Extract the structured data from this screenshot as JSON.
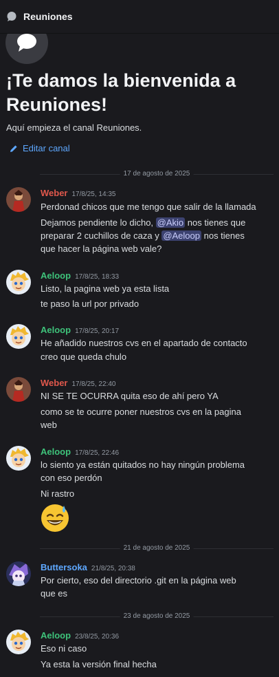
{
  "channel": {
    "name": "Reuniones",
    "welcome_title": "¡Te damos la bienvenida a Reuniones!",
    "intro": "Aquí empieza el canal Reuniones.",
    "edit_label": "Editar canal"
  },
  "colors": {
    "weber": "#e0584c",
    "aeloop": "#3ec27a",
    "buttersoka": "#5ea8ff",
    "link": "#5ea8ff"
  },
  "dividers": [
    "17 de agosto de 2025",
    "21 de agosto de 2025",
    "23 de agosto de 2025"
  ],
  "messages": [
    {
      "author": "Weber",
      "time": "17/8/25, 14:35",
      "lines": [
        "Perdonad chicos que me tengo que salir de la llamada",
        {
          "p1": "Dejamos pendiente lo dicho, ",
          "m1": "@Akio",
          "p2": " nos tienes que",
          "p3": "preparar 2 cuchillos de caza y ",
          "m2": "@Aeloop",
          "p4": " nos tienes",
          "p5": "que hacer la página web vale?"
        }
      ]
    },
    {
      "author": "Aeloop",
      "time": "17/8/25, 18:33",
      "lines": [
        "Listo, la pagina web ya esta lista",
        "te paso la url por privado"
      ]
    },
    {
      "author": "Aeloop",
      "time": "17/8/25, 20:17",
      "lines": [
        "He añadido nuestros cvs en el apartado de contacto",
        "creo que queda chulo"
      ]
    },
    {
      "author": "Weber",
      "time": "17/8/25, 22:40",
      "lines": [
        "NI SE TE OCURRA quita eso de ahí pero YA",
        "como se te ocurre poner nuestros cvs en la pagina",
        "web"
      ]
    },
    {
      "author": "Aeloop",
      "time": "17/8/25, 22:46",
      "lines": [
        "lo siento ya están quitados no hay ningún problema",
        "con eso perdón",
        "Ni rastro"
      ],
      "emoji": "sweat-smile-emoji"
    },
    {
      "author": "Buttersoka",
      "time": "21/8/25, 20:38",
      "lines": [
        "Por cierto, eso del directorio .git en la página web",
        "que es"
      ]
    },
    {
      "author": "Aeloop",
      "time": "23/8/25, 20:36",
      "lines": [
        "Eso ni caso",
        "Ya esta la versión final hecha"
      ]
    }
  ]
}
